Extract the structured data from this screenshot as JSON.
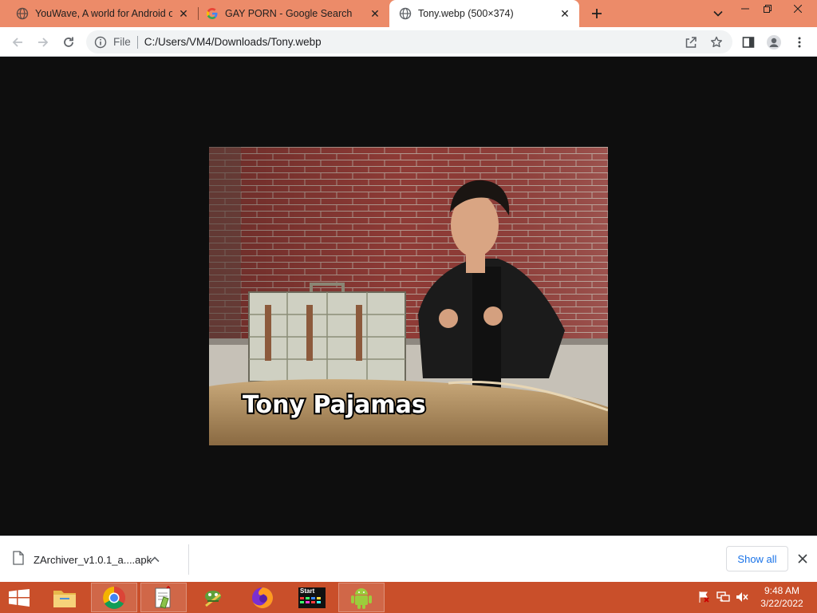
{
  "browser": {
    "tabs": [
      {
        "title": "YouWave, A world for Android on",
        "favicon": "globe-icon",
        "active": false
      },
      {
        "title": "GAY PORN - Google Search",
        "favicon": "google-icon",
        "active": false
      },
      {
        "title": "Tony.webp (500×374)",
        "favicon": "globe-icon",
        "active": true
      }
    ],
    "address": {
      "scheme_label": "File",
      "url": "C:/Users/VM4/Downloads/Tony.webp"
    }
  },
  "image": {
    "caption": "Tony Pajamas"
  },
  "downloads": {
    "file_name": "ZArchiver_v1.0.1_a....apk",
    "show_all_label": "Show all"
  },
  "taskbar": {
    "start_app_label": "Start",
    "time": "9:48 AM",
    "date": "3/22/2022"
  },
  "colors": {
    "tabstrip": "#ec8b69",
    "taskbar": "#c94f2a",
    "accent": "#1a73e8"
  }
}
